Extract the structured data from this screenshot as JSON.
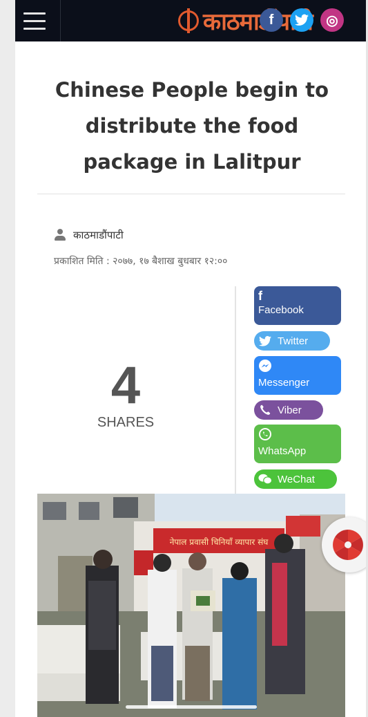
{
  "header": {
    "logo_text": "काठमाडौंपाटी",
    "social": {
      "facebook": "f",
      "twitter": "t",
      "instagram": "◎"
    }
  },
  "article": {
    "title": "Chinese People begin to distribute the food package in Lalitpur",
    "author": "काठमाडौंपाटी",
    "published": "प्रकाशित मिति : २०७७, १७ बैशाख बुधबार १२:००"
  },
  "shares": {
    "count": "4",
    "label": "SHARES"
  },
  "share_buttons": {
    "facebook": {
      "label": "Facebook",
      "color": "#3b5998"
    },
    "twitter": {
      "label": "Twitter",
      "color": "#55acee"
    },
    "messenger": {
      "label": "Messenger",
      "color": "#2f88f6"
    },
    "viber": {
      "label": "Viber",
      "color": "#7b519d"
    },
    "whatsapp": {
      "label": "WhatsApp",
      "color": "#5cbe4a"
    },
    "wechat": {
      "label": "WeChat",
      "color": "#4cc33b"
    }
  },
  "photo": {
    "banner_text": "नेपाल प्रवासी चिनियाँ व्यापार संघ"
  }
}
